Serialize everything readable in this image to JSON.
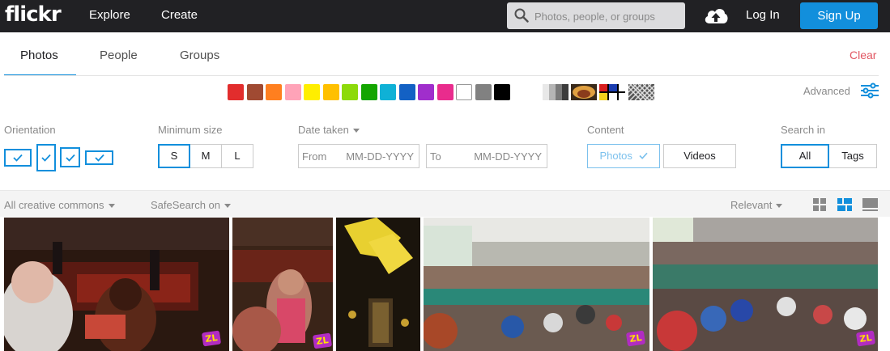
{
  "header": {
    "logo": "flickr",
    "nav": [
      "Explore",
      "Create"
    ],
    "search_placeholder": "Photos, people, or groups",
    "login_label": "Log In",
    "signup_label": "Sign Up"
  },
  "tabs": {
    "items": [
      "Photos",
      "People",
      "Groups"
    ],
    "active": "Photos",
    "clear_label": "Clear"
  },
  "color_filter": {
    "swatches": [
      "#e22d2d",
      "#a04a32",
      "#ff7f1f",
      "#ffa3b8",
      "#ffee00",
      "#ffc000",
      "#8dda0a",
      "#13a500",
      "#0fb1d6",
      "#1361c4",
      "#a02ecc",
      "#e92c8d",
      "#ffffff",
      "#818181",
      "#000000"
    ],
    "patterns": [
      "black-and-white-icon",
      "shallow-depth-of-field-icon",
      "minimalist-icon",
      "patterns-icon"
    ],
    "advanced_label": "Advanced"
  },
  "filters": {
    "orientation": {
      "label": "Orientation"
    },
    "minimum_size": {
      "label": "Minimum size",
      "options": [
        "S",
        "M",
        "L"
      ],
      "selected": "S"
    },
    "date_taken": {
      "label": "Date taken",
      "from_label": "From",
      "to_label": "To",
      "placeholder": "MM-DD-YYYY"
    },
    "content": {
      "label": "Content",
      "options": [
        "Photos",
        "Videos"
      ],
      "selected": "Photos"
    },
    "search_in": {
      "label": "Search in",
      "options": [
        "All",
        "Tags"
      ],
      "selected": "All"
    }
  },
  "sort_bar": {
    "license": "All creative commons",
    "safesearch": "SafeSearch on",
    "sort": "Relevant"
  },
  "photos": {
    "badge_text": "ZL",
    "items": [
      "children-party-photo",
      "girl-dancing-photo",
      "yellow-decoration-photo",
      "dance-hall-photo",
      "kids-dancing-photo"
    ]
  },
  "colors": {
    "topbar": "#212124",
    "accent": "#128fdc",
    "clear": "#e15662"
  }
}
